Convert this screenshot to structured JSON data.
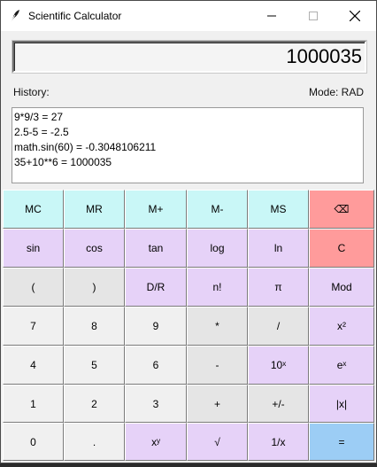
{
  "window": {
    "title": "Scientific Calculator",
    "icon": "feather-icon"
  },
  "display": {
    "value": "1000035"
  },
  "history": {
    "label": "History:",
    "mode_label": "Mode: RAD",
    "entries": [
      "9*9/3 = 27",
      "2.5-5 = -2.5",
      "math.sin(60) = -0.3048106211",
      "35+10**6 = 1000035"
    ]
  },
  "keys": {
    "row1": [
      "MC",
      "MR",
      "M+",
      "M-",
      "MS",
      "⌫"
    ],
    "row2": [
      "sin",
      "cos",
      "tan",
      "log",
      "ln",
      "C"
    ],
    "row3": [
      "(",
      ")",
      "D/R",
      "n!",
      "π",
      "Mod"
    ],
    "row4": [
      "7",
      "8",
      "9",
      "*",
      "/",
      "x²"
    ],
    "row5": [
      "4",
      "5",
      "6",
      "-",
      "10ˣ",
      "eˣ"
    ],
    "row6": [
      "1",
      "2",
      "3",
      "+",
      "+/-",
      "|x|"
    ],
    "row7": [
      "0",
      ".",
      "xʸ",
      "√",
      "1/x",
      "="
    ]
  },
  "colors": {
    "memory": "#c9f7f7",
    "function": "#e6d2f8",
    "number": "#f0f0f0",
    "operator": "#e5e5e5",
    "clear": "#ff9b9b",
    "equals": "#9ccdf5"
  }
}
